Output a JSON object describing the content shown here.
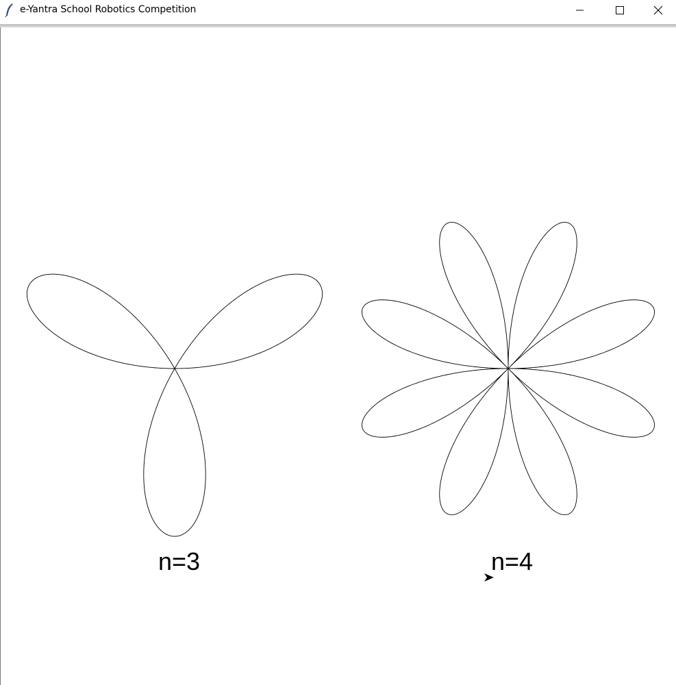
{
  "window": {
    "title": "e-Yantra School Robotics Competition",
    "icon": "feather-icon",
    "controls": [
      "minimize-icon",
      "maximize-icon",
      "close-icon"
    ]
  },
  "canvas": {
    "background": "#ffffff",
    "stroke_color": "#000000",
    "roses": [
      {
        "n": 3,
        "label": "n=3",
        "petals": 3
      },
      {
        "n": 4,
        "label": "n=4",
        "petals": 8
      }
    ],
    "turtle_cursor": "arrow-cursor-icon"
  }
}
